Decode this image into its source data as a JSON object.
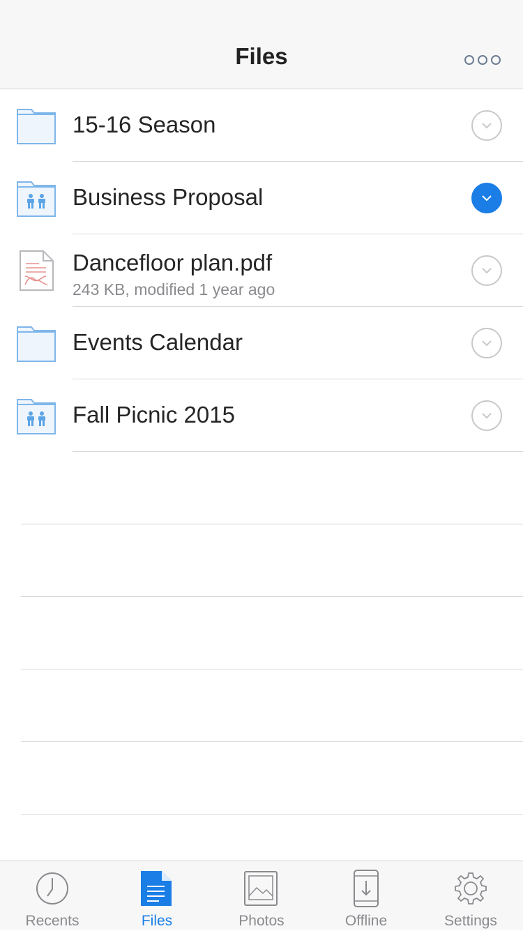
{
  "header": {
    "title": "Files"
  },
  "files": [
    {
      "name": "15-16 Season",
      "meta": "",
      "icon": "folder-icon",
      "selected": false
    },
    {
      "name": "Business Proposal",
      "meta": "",
      "icon": "shared-folder-icon",
      "selected": true
    },
    {
      "name": "Dancefloor plan.pdf",
      "meta": "243 KB, modified 1 year ago",
      "icon": "pdf-file-icon",
      "selected": false
    },
    {
      "name": "Events Calendar",
      "meta": "",
      "icon": "folder-icon",
      "selected": false
    },
    {
      "name": "Fall Picnic 2015",
      "meta": "",
      "icon": "shared-folder-icon",
      "selected": false
    }
  ],
  "tabs": [
    {
      "label": "Recents",
      "icon": "clock-icon",
      "active": false
    },
    {
      "label": "Files",
      "icon": "document-icon",
      "active": true
    },
    {
      "label": "Photos",
      "icon": "image-icon",
      "active": false
    },
    {
      "label": "Offline",
      "icon": "phone-download-icon",
      "active": false
    },
    {
      "label": "Settings",
      "icon": "gear-icon",
      "active": false
    }
  ],
  "colors": {
    "accent": "#1a7ee6",
    "folder_fill": "#eef5fd",
    "folder_stroke": "#7fb6ea",
    "pdf_accent": "#e6928f",
    "inactive": "#8a8a8e"
  }
}
